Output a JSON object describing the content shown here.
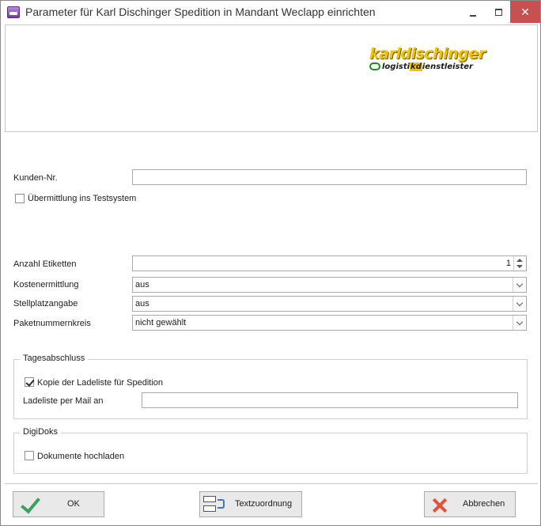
{
  "window": {
    "title": "Parameter für Karl Dischinger Spedition in Mandant Weclapp einrichten",
    "close_glyph": "✕"
  },
  "logo": {
    "line1": "karldischinger",
    "line2_pre": "logisti",
    "line2_hl": "kd",
    "line2_post": "ienstleister"
  },
  "form": {
    "kunden_nr": {
      "label": "Kunden-Nr.",
      "value": ""
    },
    "testsystem": {
      "label": "Übermittlung ins Testsystem",
      "checked": false
    },
    "anzahl_etiketten": {
      "label": "Anzahl Etiketten",
      "value": "1"
    },
    "kostenermittlung": {
      "label": "Kostenermittlung",
      "value": "aus"
    },
    "stellplatzangabe": {
      "label": "Stellplatzangabe",
      "value": "aus"
    },
    "paketnummernkreis": {
      "label": "Paketnummernkreis",
      "value": "nicht gewählt"
    }
  },
  "tagesabschluss": {
    "title": "Tagesabschluss",
    "kopie_label": "Kopie der Ladeliste für Spedition",
    "kopie_checked": true,
    "mail_label": "Ladeliste per Mail an",
    "mail_value": ""
  },
  "digidoks": {
    "title": "DigiDoks",
    "upload_label": "Dokumente hochladen",
    "upload_checked": false
  },
  "buttons": {
    "ok": "OK",
    "mapping": "Textzuordnung",
    "cancel": "Abbrechen"
  }
}
